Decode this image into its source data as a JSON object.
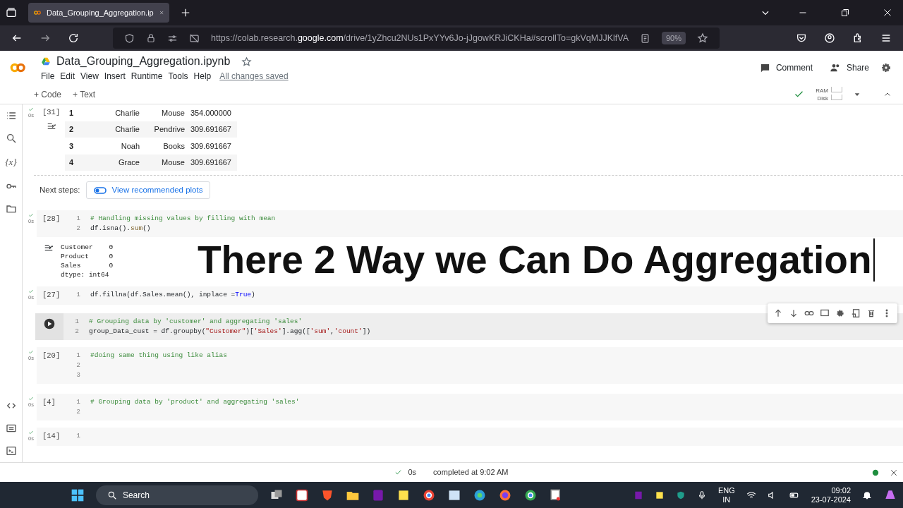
{
  "browser": {
    "tab_title": "Data_Grouping_Aggregation.ip",
    "url_prefix": "https://colab.research.",
    "url_domain": "google.com",
    "url_rest": "/drive/1yZhcu2NUs1PxYYv6Jo-jJgowKRJiCKHa#scrollTo=gkVqMJJKlfVA",
    "zoom": "90%"
  },
  "notebook": {
    "title": "Data_Grouping_Aggregation.ipynb",
    "menu": [
      "File",
      "Edit",
      "View",
      "Insert",
      "Runtime",
      "Tools",
      "Help"
    ],
    "save_status": "All changes saved",
    "comment": "Comment",
    "share": "Share"
  },
  "toolbar": {
    "add_code": "+ Code",
    "add_text": "+ Text",
    "ram": "RAM",
    "disk": "Disk"
  },
  "rail": {
    "variables": "{x}"
  },
  "output_table": {
    "count": "[31]",
    "time": "0s",
    "rows": [
      {
        "index": "1",
        "customer": "Charlie",
        "product": "Mouse",
        "sales": "354.000000"
      },
      {
        "index": "2",
        "customer": "Charlie",
        "product": "Pendrive",
        "sales": "309.691667"
      },
      {
        "index": "3",
        "customer": "Noah",
        "product": "Books",
        "sales": "309.691667"
      },
      {
        "index": "4",
        "customer": "Grace",
        "product": "Mouse",
        "sales": "309.691667"
      }
    ],
    "next_steps": "Next steps:",
    "plots_button": "View recommended plots"
  },
  "cells": [
    {
      "count": "[28]",
      "time": "0s",
      "running": false,
      "lines": [
        {
          "number": "1",
          "tokens": [
            {
              "kind": "comment",
              "text": "# Handling missing values by filling with mean"
            }
          ]
        },
        {
          "number": "2",
          "tokens": [
            {
              "kind": "plain",
              "text": "df.isna()."
            },
            {
              "kind": "func",
              "text": "sum"
            },
            {
              "kind": "plain",
              "text": "()"
            }
          ]
        }
      ],
      "output": [
        "Customer    0",
        "Product     0",
        "Sales       0",
        "dtype: int64"
      ]
    },
    {
      "count": "[27]",
      "time": "0s",
      "running": false,
      "lines": [
        {
          "number": "1",
          "tokens": [
            {
              "kind": "plain",
              "text": "df.fillna(df.Sales.mean(), inplace ="
            },
            {
              "kind": "keyword",
              "text": "True"
            },
            {
              "kind": "plain",
              "text": ")"
            }
          ]
        }
      ]
    },
    {
      "running": true,
      "lines": [
        {
          "number": "1",
          "tokens": [
            {
              "kind": "comment",
              "text": "# Grouping data by 'customer' and aggregating 'sales'"
            }
          ]
        },
        {
          "number": "2",
          "tokens": [
            {
              "kind": "plain",
              "text": "group_Data_cust = df.groupby("
            },
            {
              "kind": "string",
              "text": "\"Customer\""
            },
            {
              "kind": "plain",
              "text": ")["
            },
            {
              "kind": "string",
              "text": "'Sales'"
            },
            {
              "kind": "plain",
              "text": "].agg(["
            },
            {
              "kind": "string",
              "text": "'sum'"
            },
            {
              "kind": "plain",
              "text": ","
            },
            {
              "kind": "string",
              "text": "'count'"
            },
            {
              "kind": "plain",
              "text": "])"
            }
          ]
        }
      ]
    },
    {
      "count": "[20]",
      "time": "0s",
      "running": false,
      "lines": [
        {
          "number": "1",
          "tokens": [
            {
              "kind": "comment",
              "text": "#doing same thing using like alias"
            }
          ]
        },
        {
          "number": "2"
        },
        {
          "number": "3"
        }
      ]
    },
    {
      "count": "[4]",
      "time": "0s",
      "running": false,
      "lines": [
        {
          "number": "1",
          "tokens": [
            {
              "kind": "comment",
              "text": "# Grouping data by 'product' and aggregating 'sales'"
            }
          ]
        },
        {
          "number": "2"
        }
      ]
    },
    {
      "count": "[14]",
      "time": "0s",
      "running": false,
      "lines": [
        {
          "number": "1"
        }
      ]
    }
  ],
  "caption": "There 2 Way we Can Do Aggregation",
  "status_bar": {
    "time": "0s",
    "completed": "completed at 9:02 AM"
  },
  "taskbar": {
    "search": "Search",
    "lang1": "ENG",
    "lang2": "IN",
    "clock": "09:02",
    "date": "23-07-2024"
  }
}
